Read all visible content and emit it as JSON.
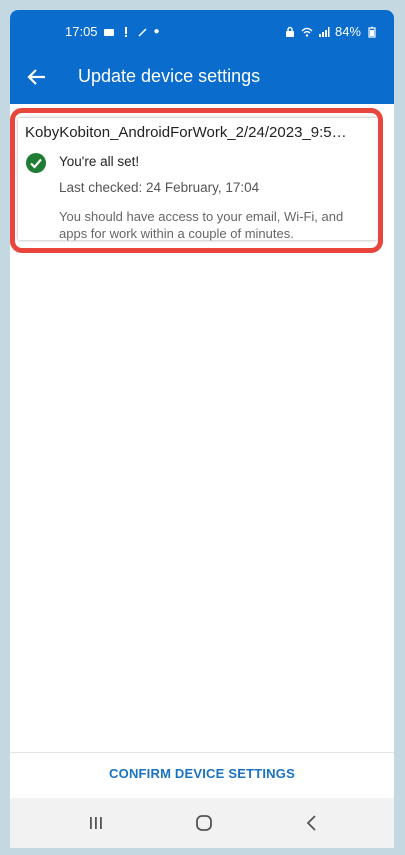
{
  "status_bar": {
    "time": "17:05",
    "battery": "84%"
  },
  "app_bar": {
    "title": "Update device settings"
  },
  "card": {
    "title": "KobyKobiton_AndroidForWork_2/24/2023_9:5…",
    "status_title": "You're all set!",
    "last_checked": "Last checked: 24 February, 17:04",
    "description": "You should have access to your email, Wi-Fi, and apps for work within a couple of minutes."
  },
  "footer": {
    "confirm_label": "CONFIRM DEVICE SETTINGS"
  },
  "colors": {
    "primary": "#0a6ccc",
    "success": "#1e7d32",
    "highlight": "#e8453c",
    "link": "#1a73c0"
  },
  "icons": [
    "back-arrow-icon",
    "check-circle-icon",
    "recent-apps-icon",
    "home-icon",
    "nav-back-icon"
  ]
}
